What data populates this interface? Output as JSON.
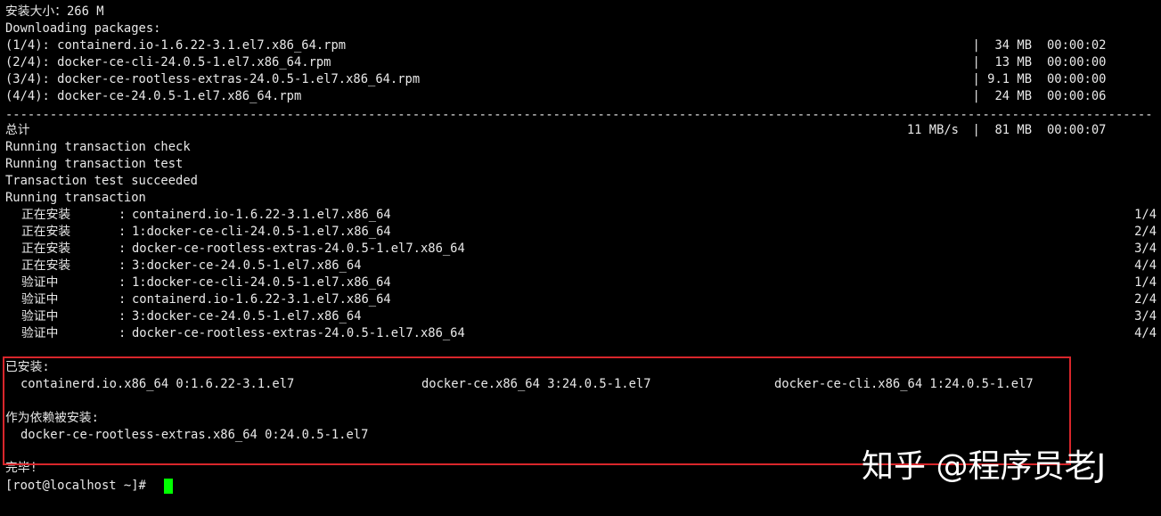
{
  "terminal": {
    "header": {
      "install_size": "安装大小：266 M",
      "downloading": "Downloading packages:"
    },
    "downloads": [
      {
        "name": "(1/4): containerd.io-1.6.22-3.1.el7.x86_64.rpm",
        "size": "|  34 MB",
        "time": "00:00:02"
      },
      {
        "name": "(2/4): docker-ce-cli-24.0.5-1.el7.x86_64.rpm",
        "size": "|  13 MB",
        "time": "00:00:00"
      },
      {
        "name": "(3/4): docker-ce-rootless-extras-24.0.5-1.el7.x86_64.rpm",
        "size": "| 9.1 MB",
        "time": "00:00:00"
      },
      {
        "name": "(4/4): docker-ce-24.0.5-1.el7.x86_64.rpm",
        "size": "|  24 MB",
        "time": "00:00:06"
      }
    ],
    "divider": "--------------------------------------------------------------------------------------------------------------------------------------------------------------------------------",
    "total": {
      "label": "总计",
      "speed": "11 MB/s",
      "size": "|  81 MB",
      "time": "00:00:07"
    },
    "transaction_lines": [
      "Running transaction check",
      "Running transaction test",
      "Transaction test succeeded",
      "Running transaction"
    ],
    "steps": [
      {
        "action": "正在安装",
        "sep": ":",
        "pkg": "containerd.io-1.6.22-3.1.el7.x86_64",
        "count": "1/4"
      },
      {
        "action": "正在安装",
        "sep": ":",
        "pkg": "1:docker-ce-cli-24.0.5-1.el7.x86_64",
        "count": "2/4"
      },
      {
        "action": "正在安装",
        "sep": ":",
        "pkg": "docker-ce-rootless-extras-24.0.5-1.el7.x86_64",
        "count": "3/4"
      },
      {
        "action": "正在安装",
        "sep": ":",
        "pkg": "3:docker-ce-24.0.5-1.el7.x86_64",
        "count": "4/4"
      },
      {
        "action": "验证中",
        "sep": ":",
        "pkg": "1:docker-ce-cli-24.0.5-1.el7.x86_64",
        "count": "1/4"
      },
      {
        "action": "验证中",
        "sep": ":",
        "pkg": "containerd.io-1.6.22-3.1.el7.x86_64",
        "count": "2/4"
      },
      {
        "action": "验证中",
        "sep": ":",
        "pkg": "3:docker-ce-24.0.5-1.el7.x86_64",
        "count": "3/4"
      },
      {
        "action": "验证中",
        "sep": ":",
        "pkg": "docker-ce-rootless-extras-24.0.5-1.el7.x86_64",
        "count": "4/4"
      }
    ],
    "installed": {
      "label": "已安装:",
      "packages": [
        "containerd.io.x86_64 0:1.6.22-3.1.el7",
        "docker-ce.x86_64 3:24.0.5-1.el7",
        "docker-ce-cli.x86_64 1:24.0.5-1.el7"
      ]
    },
    "dependency": {
      "label": "作为依赖被安装:",
      "packages": [
        "docker-ce-rootless-extras.x86_64 0:24.0.5-1.el7"
      ]
    },
    "complete": "完毕!",
    "prompt": "[root@localhost ~]#"
  },
  "watermark": "知乎 @程序员老J",
  "colors": {
    "background": "#000000",
    "text": "#e8e8e8",
    "highlight_border": "#d8262b",
    "cursor": "#00ff00"
  }
}
